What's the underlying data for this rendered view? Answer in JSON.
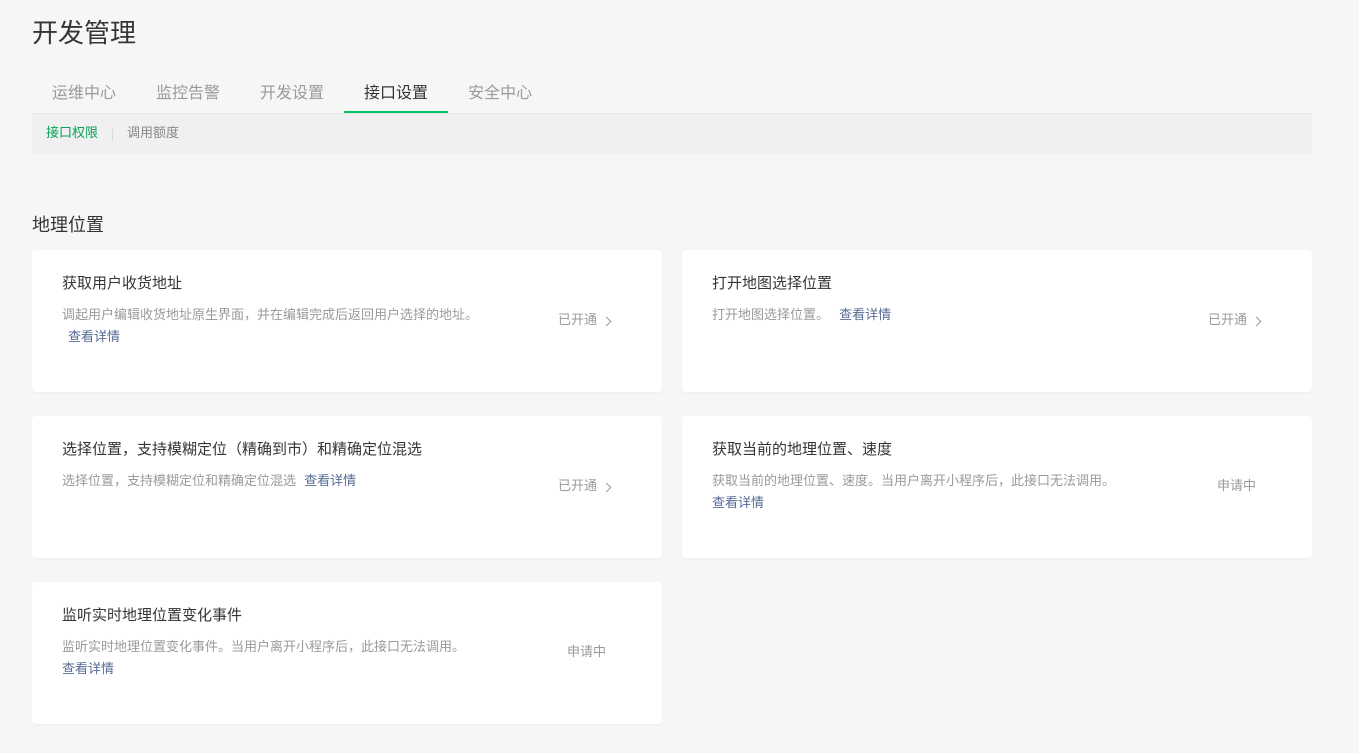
{
  "page_title": "开发管理",
  "tabs": [
    {
      "label": "运维中心",
      "active": false
    },
    {
      "label": "监控告警",
      "active": false
    },
    {
      "label": "开发设置",
      "active": false
    },
    {
      "label": "接口设置",
      "active": true
    },
    {
      "label": "安全中心",
      "active": false
    }
  ],
  "subnav": [
    {
      "label": "接口权限",
      "active": true
    },
    {
      "label": "调用额度",
      "active": false
    }
  ],
  "section_title": "地理位置",
  "cards": [
    {
      "title": "获取用户收货地址",
      "desc": "调起用户编辑收货地址原生界面，并在编辑完成后返回用户选择的地址。",
      "link": "查看详情",
      "status": "已开通",
      "has_chevron": true
    },
    {
      "title": "打开地图选择位置",
      "desc": "打开地图选择位置。",
      "link": "查看详情",
      "status": "已开通",
      "has_chevron": true
    },
    {
      "title": "选择位置，支持模糊定位（精确到市）和精确定位混选",
      "desc": "选择位置，支持模糊定位和精确定位混选",
      "link": "查看详情",
      "status": "已开通",
      "has_chevron": true
    },
    {
      "title": "获取当前的地理位置、速度",
      "desc": "获取当前的地理位置、速度。当用户离开小程序后，此接口无法调用。",
      "link": "查看详情",
      "status": "申请中",
      "has_chevron": false
    },
    {
      "title": "监听实时地理位置变化事件",
      "desc": "监听实时地理位置变化事件。当用户离开小程序后，此接口无法调用。",
      "link": "查看详情",
      "status": "申请中",
      "has_chevron": false
    }
  ],
  "colors": {
    "accent": "#07c160",
    "link": "#576b95",
    "muted": "#9a9a9a",
    "background": "#f6f6f6"
  },
  "icons": {
    "status_arrow": "chevron-right-icon"
  }
}
